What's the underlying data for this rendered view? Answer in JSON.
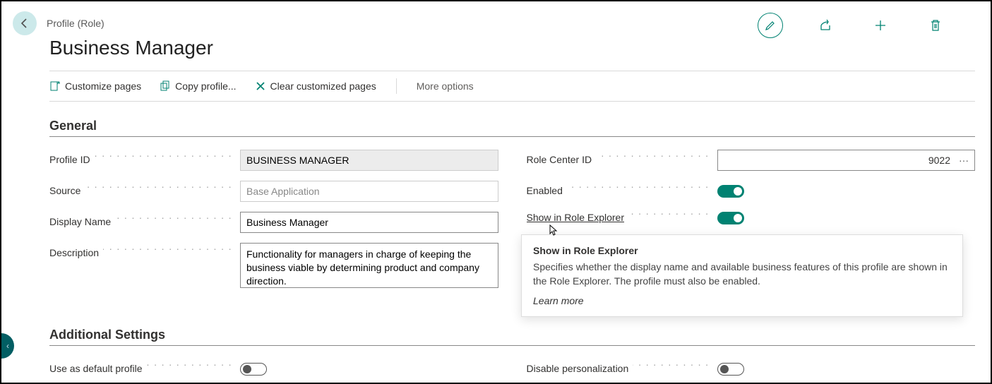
{
  "header": {
    "breadcrumb": "Profile (Role)",
    "title": "Business Manager"
  },
  "toolbar": {
    "customize": "Customize pages",
    "copy": "Copy profile...",
    "clear": "Clear customized pages",
    "more": "More options"
  },
  "sections": {
    "general": "General",
    "additional": "Additional Settings"
  },
  "fields": {
    "profile_id": {
      "label": "Profile ID",
      "value": "BUSINESS MANAGER"
    },
    "source": {
      "label": "Source",
      "value": "Base Application"
    },
    "display_name": {
      "label": "Display Name",
      "value": "Business Manager"
    },
    "description": {
      "label": "Description",
      "value": "Functionality for managers in charge of keeping the business viable by determining product and company direction."
    },
    "role_center_id": {
      "label": "Role Center ID",
      "value": "9022"
    },
    "enabled": {
      "label": "Enabled",
      "value": true
    },
    "show_in_explorer": {
      "label": "Show in Role Explorer",
      "value": true
    },
    "use_default": {
      "label": "Use as default profile",
      "value": false
    },
    "disable_personalization": {
      "label": "Disable personalization",
      "value": false
    }
  },
  "tooltip": {
    "title": "Show in Role Explorer",
    "body": "Specifies whether the display name and available business features of this profile are shown in the Role Explorer. The profile must also be enabled.",
    "learn": "Learn more"
  },
  "lookup_ellipsis": "···"
}
